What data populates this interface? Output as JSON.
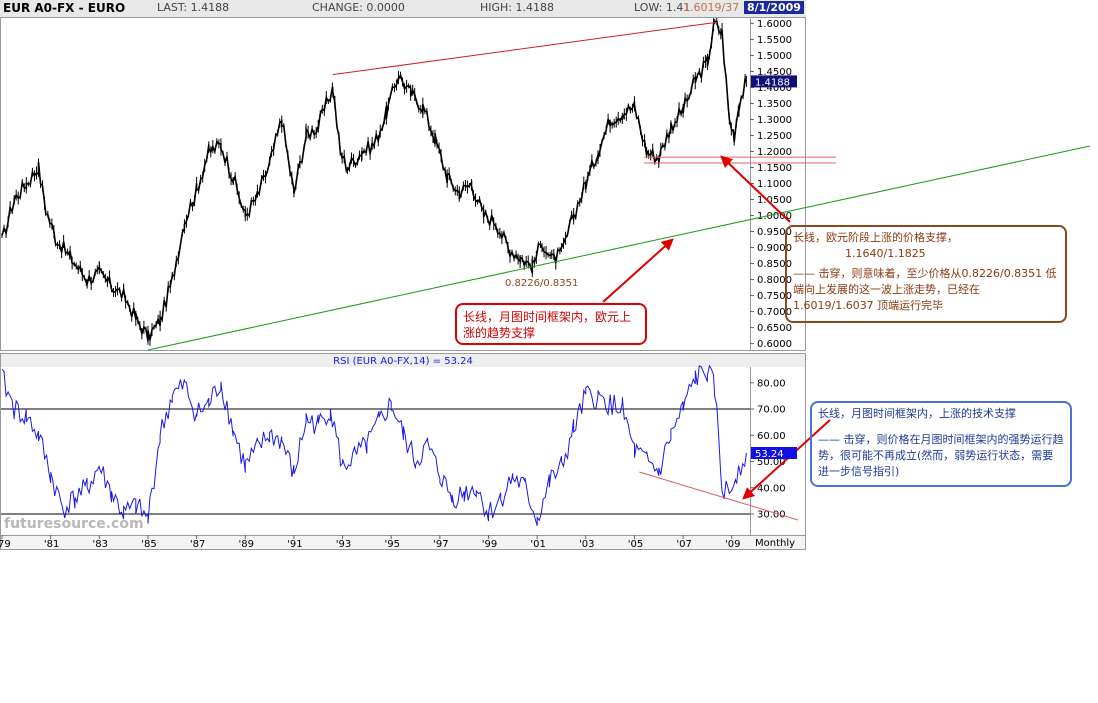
{
  "header": {
    "title": "EUR A0-FX - EURO",
    "last": "LAST: 1.4188",
    "change": "CHANGE: 0.0000",
    "high": "HIGH: 1.4188",
    "low": "LOW: 1.41",
    "high_note": "1.6019/37",
    "date": "8/1/2009"
  },
  "rsi_header": "RSI (EUR A0-FX,14) = 53.24",
  "watermark": "futuresource.com",
  "period": "Monthly",
  "price_tag": "1.4188",
  "rsi_tag": "53.24",
  "low_label": "0.8226/0.8351",
  "support_band_label": "1.1640/1.1825",
  "notes": {
    "brown_title": "长线，欧元阶段上涨的价格支撑，",
    "brown_value": "1.1640/1.1825",
    "brown_body": "—— 击穿，则意味着，至少价格从0.8226/0.8351 低端向上发展的这一波上涨走势，已经在1.6019/1.6037 顶端运行完毕",
    "red_text": "长线，月图时间框架内，欧元上涨的趋势支撑",
    "blue_title": "长线，月图时间框架内，上涨的技术支撑",
    "blue_body": "—— 击穿，则价格在月图时间框架内的强势运行趋势，很可能不再成立(然而，弱势运行状态，需要进一步信号指引)"
  },
  "colors": {
    "price": "#000000",
    "rsi": "#1a1ae6",
    "upper_trend": "#d42020",
    "lower_trend": "#1a9a1a",
    "band": "#e06060",
    "arrow": "#e00000",
    "tag": "#10107a",
    "rsi_tag": "#1010e0"
  },
  "chart_data": [
    {
      "type": "line",
      "title": "EUR A0-FX - EURO",
      "x": [
        1979.0,
        1979.5,
        1980.0,
        1980.5,
        1980.8,
        1981.2,
        1981.8,
        1982.5,
        1983.0,
        1983.5,
        1984.0,
        1984.5,
        1985.0,
        1985.5,
        1986.0,
        1986.5,
        1987.0,
        1987.5,
        1988.0,
        1988.5,
        1989.0,
        1989.5,
        1990.0,
        1990.5,
        1991.0,
        1991.5,
        1992.0,
        1992.6,
        1992.9,
        1993.2,
        1993.8,
        1994.3,
        1994.8,
        1995.3,
        1995.8,
        1996.3,
        1996.8,
        1997.3,
        1997.8,
        1998.3,
        1998.8,
        1999.3,
        1999.8,
        2000.3,
        2000.8,
        2001.2,
        2001.6,
        2002.0,
        2002.5,
        2003.0,
        2003.5,
        2004.0,
        2004.5,
        2005.0,
        2005.5,
        2006.0,
        2006.5,
        2007.0,
        2007.5,
        2008.0,
        2008.3,
        2008.6,
        2008.9,
        2009.1,
        2009.3,
        2009.6
      ],
      "y": [
        0.92,
        1.05,
        1.1,
        1.15,
        1.02,
        0.93,
        0.87,
        0.8,
        0.82,
        0.78,
        0.75,
        0.68,
        0.62,
        0.67,
        0.8,
        0.98,
        1.08,
        1.2,
        1.22,
        1.12,
        1.0,
        1.06,
        1.16,
        1.3,
        1.07,
        1.25,
        1.28,
        1.4,
        1.2,
        1.15,
        1.2,
        1.22,
        1.32,
        1.44,
        1.38,
        1.34,
        1.24,
        1.12,
        1.07,
        1.1,
        1.0,
        0.98,
        0.9,
        0.87,
        0.84,
        0.92,
        0.86,
        0.88,
        1.0,
        1.1,
        1.2,
        1.3,
        1.32,
        1.34,
        1.2,
        1.18,
        1.28,
        1.33,
        1.42,
        1.48,
        1.6,
        1.57,
        1.3,
        1.25,
        1.35,
        1.4188
      ],
      "xlabel": "",
      "ylabel": "",
      "ylim": [
        0.58,
        1.62
      ],
      "yticks": [
        0.6,
        0.65,
        0.7,
        0.75,
        0.8,
        0.85,
        0.9,
        0.95,
        1.0,
        1.05,
        1.1,
        1.15,
        1.2,
        1.25,
        1.3,
        1.35,
        1.4,
        1.45,
        1.5,
        1.55,
        1.6
      ],
      "ytick_labels": [
        "0.6000",
        "0.6500",
        "0.7000",
        "0.7500",
        "0.8000",
        "0.8500",
        "0.9000",
        "0.9500",
        "1.0000",
        "1.0500",
        "1.1000",
        "1.1500",
        "1.2000",
        "1.2500",
        "1.3000",
        "1.3500",
        "1.4000",
        "1.4500",
        "1.5000",
        "1.5500",
        "1.6000"
      ],
      "trendlines": [
        {
          "x": [
            1992.6,
            2008.4
          ],
          "y": [
            1.44,
            1.6037
          ]
        },
        {
          "x": [
            1985.0,
            2017.5
          ],
          "y": [
            0.58,
            1.2
          ]
        }
      ],
      "support_band": [
        1.164,
        1.1825
      ],
      "annotation": "0.8226/0.8351"
    },
    {
      "type": "line",
      "title": "RSI (EUR A0-FX,14) = 53.24",
      "x": [
        1979.0,
        1979.5,
        1980.0,
        1980.5,
        1981.0,
        1981.5,
        1982.0,
        1982.5,
        1983.0,
        1983.5,
        1984.0,
        1984.5,
        1985.0,
        1985.5,
        1986.0,
        1986.5,
        1987.0,
        1987.5,
        1988.0,
        1988.5,
        1989.0,
        1989.5,
        1990.0,
        1990.5,
        1991.0,
        1991.5,
        1992.0,
        1992.5,
        1993.0,
        1993.5,
        1994.0,
        1994.5,
        1995.0,
        1995.5,
        1996.0,
        1996.5,
        1997.0,
        1997.5,
        1998.0,
        1998.5,
        1999.0,
        1999.5,
        2000.0,
        2000.5,
        2001.0,
        2001.5,
        2002.0,
        2002.5,
        2003.0,
        2003.5,
        2004.0,
        2004.5,
        2005.0,
        2005.5,
        2006.0,
        2006.5,
        2007.0,
        2007.5,
        2008.0,
        2008.3,
        2008.6,
        2008.9,
        2009.2,
        2009.6
      ],
      "y": [
        82,
        70,
        67,
        60,
        45,
        32,
        36,
        40,
        48,
        38,
        30,
        33,
        28,
        60,
        75,
        79,
        68,
        72,
        80,
        62,
        48,
        55,
        60,
        58,
        45,
        66,
        64,
        70,
        48,
        52,
        56,
        65,
        72,
        60,
        50,
        56,
        45,
        36,
        38,
        40,
        30,
        36,
        44,
        40,
        28,
        42,
        48,
        62,
        75,
        74,
        72,
        70,
        54,
        50,
        46,
        60,
        70,
        82,
        84,
        78,
        40,
        38,
        46,
        53.24
      ],
      "xlabel": "",
      "ylabel": "",
      "ylim": [
        22,
        86
      ],
      "yticks": [
        30,
        40,
        50,
        60,
        70,
        80
      ],
      "ytick_labels": [
        "30.00",
        "40.00",
        "50.00",
        "60.00",
        "70.00",
        "80.00"
      ],
      "reference_lines": [
        30,
        70
      ],
      "trendline": {
        "x": [
          2005.2,
          2012.0
        ],
        "y": [
          46,
          26
        ]
      }
    }
  ],
  "x_axis": {
    "ticks": [
      1979,
      1981,
      1983,
      1985,
      1987,
      1989,
      1991,
      1993,
      1995,
      1997,
      1999,
      2001,
      2003,
      2005,
      2007,
      2009
    ],
    "labels": [
      "'79",
      "'81",
      "'83",
      "'85",
      "'87",
      "'89",
      "'91",
      "'93",
      "'95",
      "'97",
      "'99",
      "'01",
      "'03",
      "'05",
      "'07",
      "'09"
    ]
  }
}
